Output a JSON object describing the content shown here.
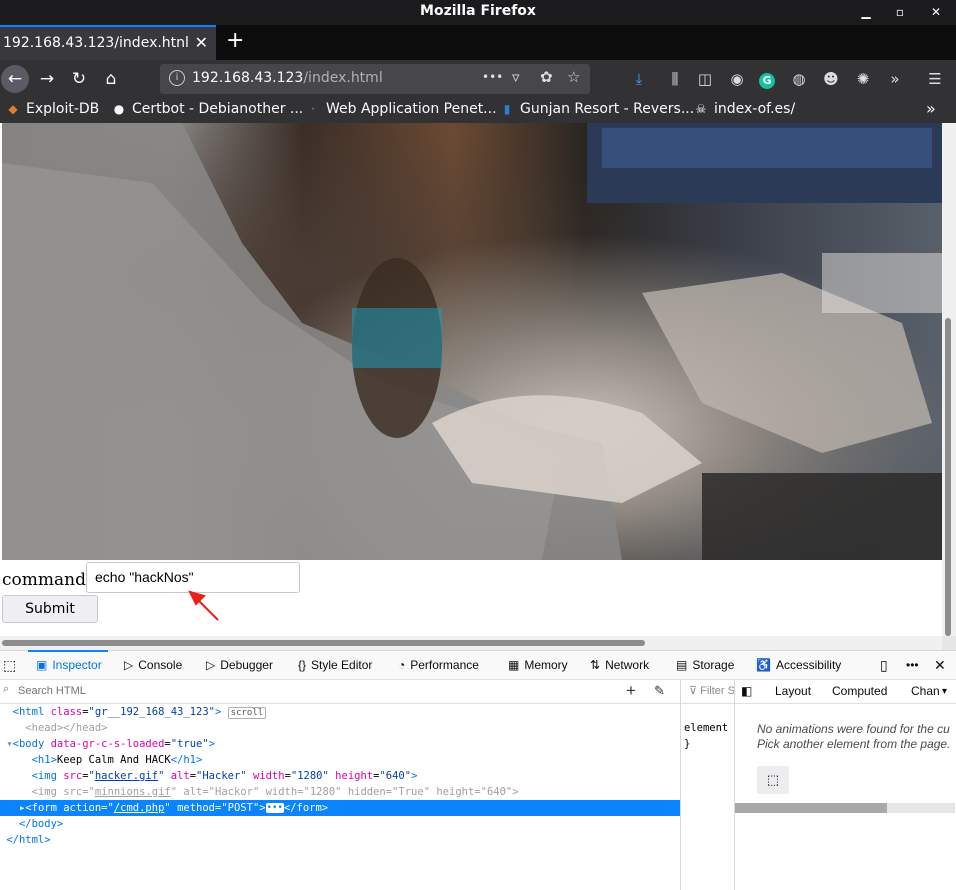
{
  "window": {
    "title": "Mozilla Firefox"
  },
  "tab": {
    "label": "192.168.43.123/index.htnl",
    "close": "✕",
    "new_tab": "+"
  },
  "urlbar": {
    "host": "192.168.43.123",
    "path": "/index.html",
    "more": "•••"
  },
  "bookmarks": [
    {
      "label": "Exploit-DB"
    },
    {
      "label": "Certbot - Debianother ..."
    },
    {
      "label": "Web Application Penet..."
    },
    {
      "label": "Gunjan Resort - Revers..."
    },
    {
      "label": "index-of.es/"
    }
  ],
  "page": {
    "command_label": "command",
    "command_value": "echo \"hackNos\"",
    "submit_label": "Submit"
  },
  "devtools": {
    "tabs": [
      "Inspector",
      "Console",
      "Debugger",
      "Style Editor",
      "Performance",
      "Memory",
      "Network",
      "Storage",
      "Accessibility"
    ],
    "search_placeholder": "Search HTML",
    "filter_placeholder": "Filter S",
    "rule_selector": "element",
    "rule_close": "}",
    "side_tabs": [
      "Layout",
      "Computed",
      "Chan"
    ],
    "animations_msg_1": "No animations were found for the cu",
    "animations_msg_2": "Pick another element from the page."
  },
  "markup": {
    "html_tag": "html",
    "html_class_attr": "class",
    "html_class_val": "gr__192_168_43_123",
    "scroll_badge": "scroll",
    "head": "<head></head>",
    "body_tag": "body",
    "body_attr": "data-gr-c-s-loaded",
    "body_val": "true",
    "h1_text": "Keep Calm And HACK",
    "img1_src": "hacker.gif",
    "img1_alt": "Hacker",
    "img1_width": "1280",
    "img1_height": "640",
    "img2_src": "minnions.gif",
    "img2_alt": "Hackor",
    "img2_width": "1280",
    "img2_hidden": "True",
    "img2_height": "640",
    "form_action": "/cmd.php",
    "form_method": "POST",
    "close_body": "</body>",
    "close_html": "</html>"
  },
  "colors": {
    "accent": "#0a84ff",
    "annotation_arrow": "#e8221b"
  }
}
